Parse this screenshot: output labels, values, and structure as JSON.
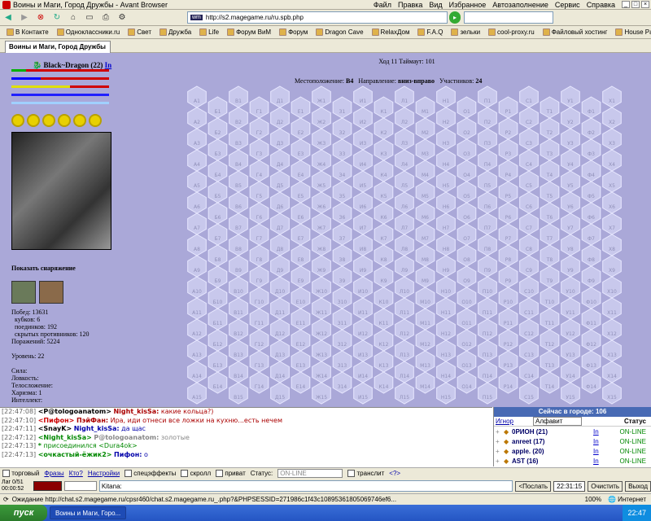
{
  "window": {
    "title": "Воины и Маги, Город Дружбы - Avant Browser"
  },
  "menu": [
    "Файл",
    "Правка",
    "Вид",
    "Избранное",
    "Автозаполнение",
    "Сервис",
    "Справка"
  ],
  "address": {
    "url": "http://s2.magegame.ru/ru.spb.php"
  },
  "favorites": [
    "В Контакте",
    "Одноклассники.ru",
    "Свет",
    "Дружба",
    "Life",
    "Форум ВиМ",
    "Форум",
    "Dragon Cave",
    "RelaxДом",
    "F.A.Q",
    "зельки",
    "cool-proxy.ru",
    "Файловый хостинг",
    "House Party"
  ],
  "tab": {
    "label": "Воины и Маги, Город Дружбы"
  },
  "player": {
    "name": "Black~Dragon",
    "level": "(22)",
    "clan": "In"
  },
  "bars": [
    {
      "color": "#d00000",
      "bg": "#d00000",
      "fill": 0.15,
      "fill_color": "#00b000"
    },
    {
      "color": "#0000ff",
      "bg": "#d00000",
      "fill": 0.3,
      "fill_color": "#0000ff"
    },
    {
      "color": "#ffff00",
      "bg": "#d00000",
      "fill": 0.6,
      "fill_color": "#e0e000"
    },
    {
      "color": "#0000c0",
      "bg": "#d00000",
      "fill": 1.0,
      "fill_color": "#2020ff"
    },
    {
      "color": "#a0d0ff",
      "bg": "#a0d0ff",
      "fill": 1.0,
      "fill_color": "#a0d0ff"
    }
  ],
  "equipment": {
    "show_label": "Показать снаряжение"
  },
  "stats": [
    "Побед: 13631",
    "  кубков: 6",
    "  поединков: 192",
    "  скрытых противников: 120",
    "Поражений: 5224",
    "",
    "Уровень: 22",
    "",
    "Сила:",
    "Ловкость:",
    "Телосложение:",
    "Харизма: 1",
    "Интеллект:"
  ],
  "game": {
    "turn": "Ход 11 Таймаут: 101",
    "location_label": "Местоположение:",
    "location": "В4",
    "direction_label": "Направление:",
    "direction": "вниз-вправо",
    "participants_label": "Участников:",
    "participants": "24"
  },
  "hex_cols": [
    "А",
    "Б",
    "В",
    "Г",
    "Д",
    "Е",
    "Ж",
    "З",
    "И",
    "К",
    "Л",
    "М",
    "Н",
    "О",
    "П",
    "Р",
    "С",
    "Т",
    "У",
    "Ф",
    "Х"
  ],
  "hex_rows": 15,
  "chat": [
    {
      "ts": "[22:47:08]",
      "nick": "<P@tologoanatom>",
      "to": "Night_kisSa:",
      "text": "какие кольца?)",
      "nc": "#000",
      "tc": "#a00"
    },
    {
      "ts": "[22:47:10]",
      "nick": "<Пифон>",
      "to": "ПэйФан:",
      "text": "Ира, иди отнеси все ложки на кухню...есть нечем",
      "nc": "#c00",
      "tc": "#a00"
    },
    {
      "ts": "[22:47:11]",
      "nick": "<SnayK>",
      "to": "Night_kisSa:",
      "text": "да щас",
      "nc": "#000",
      "tc": "#00a"
    },
    {
      "ts": "[22:47:12]",
      "nick": "<Night_kisSa>",
      "to": "P@tologoanatom:",
      "text": "золотые",
      "nc": "#080",
      "tc": "#888"
    },
    {
      "ts": "[22:47:13]",
      "nick": "*",
      "to": "",
      "text": "присоединился <Dura4ok>",
      "nc": "#080",
      "tc": "#080"
    },
    {
      "ts": "[22:47:13]",
      "nick": "<очкастый-ёжик2>",
      "to": "Пифон:",
      "text": "о",
      "nc": "#080",
      "tc": "#00a"
    }
  ],
  "online": {
    "header": "Сейчас в городе:",
    "count": "106",
    "col_ignore": "Игнор",
    "col_sort": "Алфавит",
    "col_status": "Статус",
    "users": [
      {
        "name": "0РИОН (21)",
        "clan": "In",
        "status": "ON-LINE"
      },
      {
        "name": "anreet (17)",
        "clan": "In",
        "status": "ON-LINE"
      },
      {
        "name": "apple. (20)",
        "clan": "In",
        "status": "ON-LINE"
      },
      {
        "name": "AST (16)",
        "clan": "In",
        "status": "ON-LINE"
      }
    ]
  },
  "options": {
    "trade": "торговый",
    "phrases": "Фразы",
    "who": "Кто?",
    "settings": "Настройки",
    "effects": "спецэффекты",
    "scroll": "скролл",
    "private": "приват",
    "status_label": "Статус:",
    "status_value": "ON-LINE",
    "translit": "транслит",
    "help": "<?>"
  },
  "input": {
    "lag": "Лаг 0/51",
    "timer": "00:00:52",
    "prefix": "Kitana:",
    "send": "<Послать",
    "time": "22:31:15",
    "clear": "Очистить",
    "exit": "Выход"
  },
  "status": {
    "text": "Ожидание http://chat.s2.magegame.ru/cpsr460/chat.s2.magegame.ru_.php?&PHPSESSID=271986c1f43c10895361805069746ef6...",
    "zoom": "100%",
    "zone": "Интернет"
  },
  "taskbar": {
    "start": "пуск",
    "item": "Воины и Маги, Горо...",
    "clock": "22:47"
  }
}
